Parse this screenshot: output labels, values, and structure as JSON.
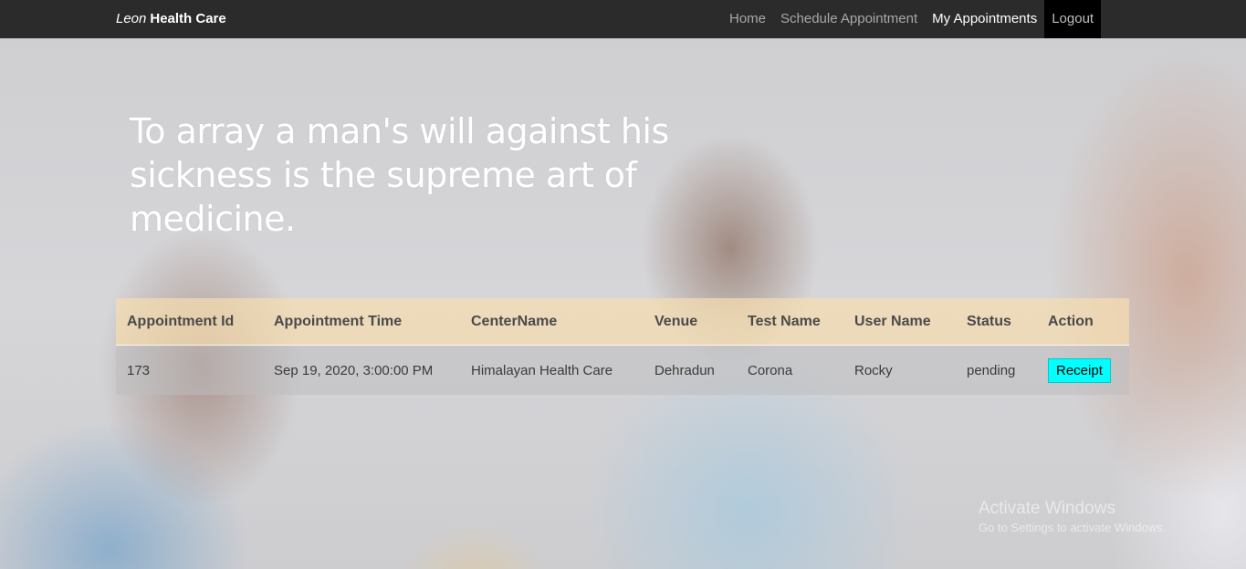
{
  "navbar": {
    "brand_italic": "Leon",
    "brand_bold": "Health Care",
    "items": [
      {
        "label": "Home"
      },
      {
        "label": "Schedule Appointment"
      },
      {
        "label": "My Appointments"
      },
      {
        "label": "Logout"
      }
    ]
  },
  "hero": {
    "quote": "To array a man's will against his sickness is the supreme art of medicine."
  },
  "table": {
    "headers": [
      "Appointment Id",
      "Appointment Time",
      "CenterName",
      "Venue",
      "Test Name",
      "User Name",
      "Status",
      "Action"
    ],
    "rows": [
      {
        "id": "173",
        "time": "Sep 19, 2020, 3:00:00 PM",
        "center": "Himalayan Health Care",
        "venue": "Dehradun",
        "test": "Corona",
        "user": "Rocky",
        "status": "pending",
        "action": "Receipt"
      }
    ]
  },
  "watermark": {
    "title": "Activate Windows",
    "subtitle": "Go to Settings to activate Windows."
  },
  "colors": {
    "navbar_bg": "#2b2b2b",
    "logout_bg": "#000000",
    "header_row": "#f5dcaf",
    "receipt_button": "#00ffff"
  }
}
